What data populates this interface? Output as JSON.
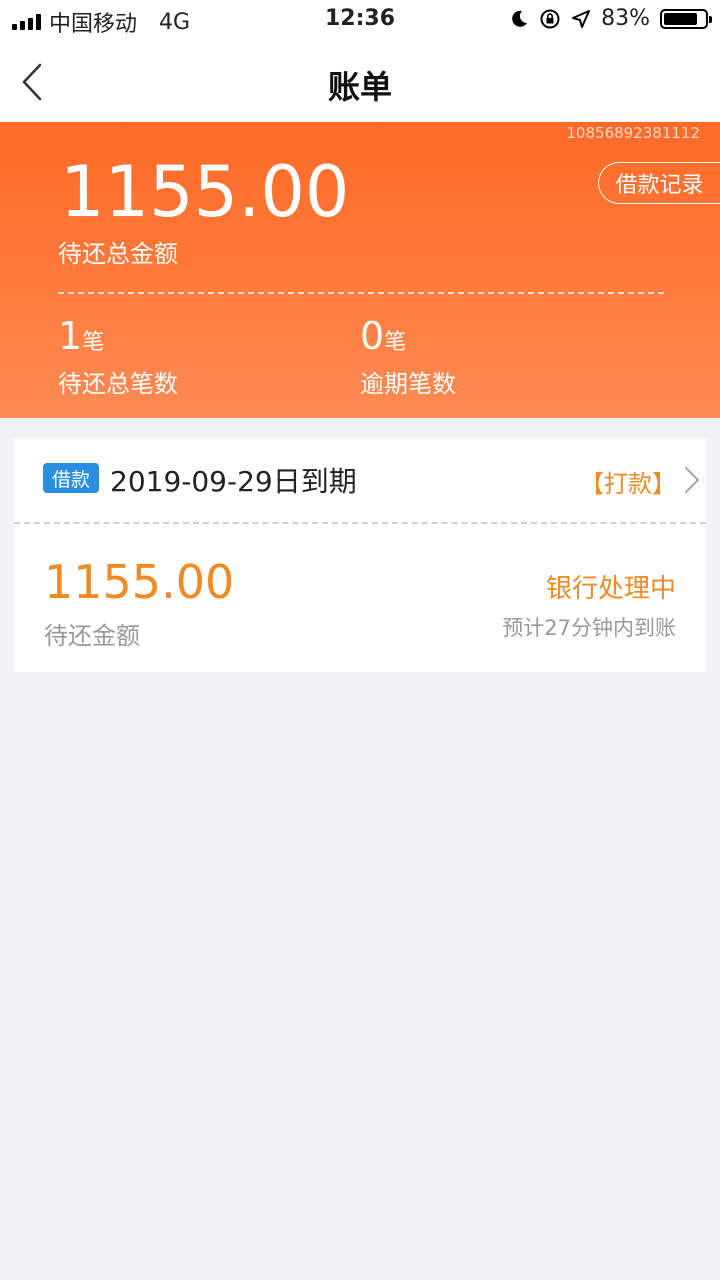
{
  "status_bar": {
    "carrier": "中国移动",
    "network": "4G",
    "time": "12:36",
    "battery": "83%",
    "battery_level": 0.83
  },
  "nav": {
    "title": "账单"
  },
  "summary": {
    "account_no": "10856892381112",
    "records_label": "借款记录",
    "total_amount": "1155.00",
    "total_label": "待还总金额",
    "pending_count": "1",
    "pending_unit": "笔",
    "pending_label": "待还总笔数",
    "overdue_count": "0",
    "overdue_unit": "笔",
    "overdue_label": "逾期笔数"
  },
  "loan": {
    "tag": "借款",
    "due_date": "2019-09-29日到期",
    "transfer_label": "【打款】",
    "amount": "1155.00",
    "amount_label": "待还金额",
    "status": "银行处理中",
    "eta": "预计27分钟内到账"
  },
  "colors": {
    "accent_orange": "#f08a24",
    "header_orange": "#ff6a28",
    "tag_blue": "#2a8ee0"
  }
}
